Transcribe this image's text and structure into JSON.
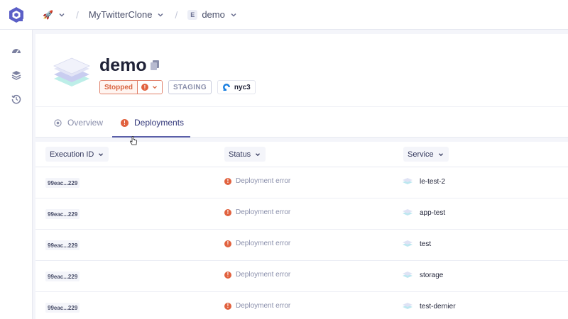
{
  "topbar": {
    "org_emoji": "🚀",
    "project_name": "MyTwitterClone",
    "env_letter": "E",
    "env_name": "demo",
    "separator": "/"
  },
  "environment": {
    "name": "demo",
    "status": "Stopped",
    "status_indicator": "!",
    "mode": "STAGING",
    "region": "nyc3"
  },
  "tabs": [
    {
      "label": "Overview",
      "icon": "overview-icon",
      "active": false
    },
    {
      "label": "Deployments",
      "icon": "error-icon",
      "active": true
    }
  ],
  "table": {
    "columns": [
      "Execution ID",
      "Status",
      "Service"
    ],
    "rows": [
      {
        "execution_id": "99eac...229",
        "status": "Deployment error",
        "service": "le-test-2"
      },
      {
        "execution_id": "99eac...229",
        "status": "Deployment error",
        "service": "app-test"
      },
      {
        "execution_id": "99eac...229",
        "status": "Deployment error",
        "service": "test"
      },
      {
        "execution_id": "99eac...229",
        "status": "Deployment error",
        "service": "storage"
      },
      {
        "execution_id": "99eac...229",
        "status": "Deployment error",
        "service": "test-dernier"
      }
    ]
  },
  "colors": {
    "accent": "#5a5fa8",
    "error": "#e1623f",
    "muted": "#8a8fab",
    "background": "#f4f5fa"
  }
}
